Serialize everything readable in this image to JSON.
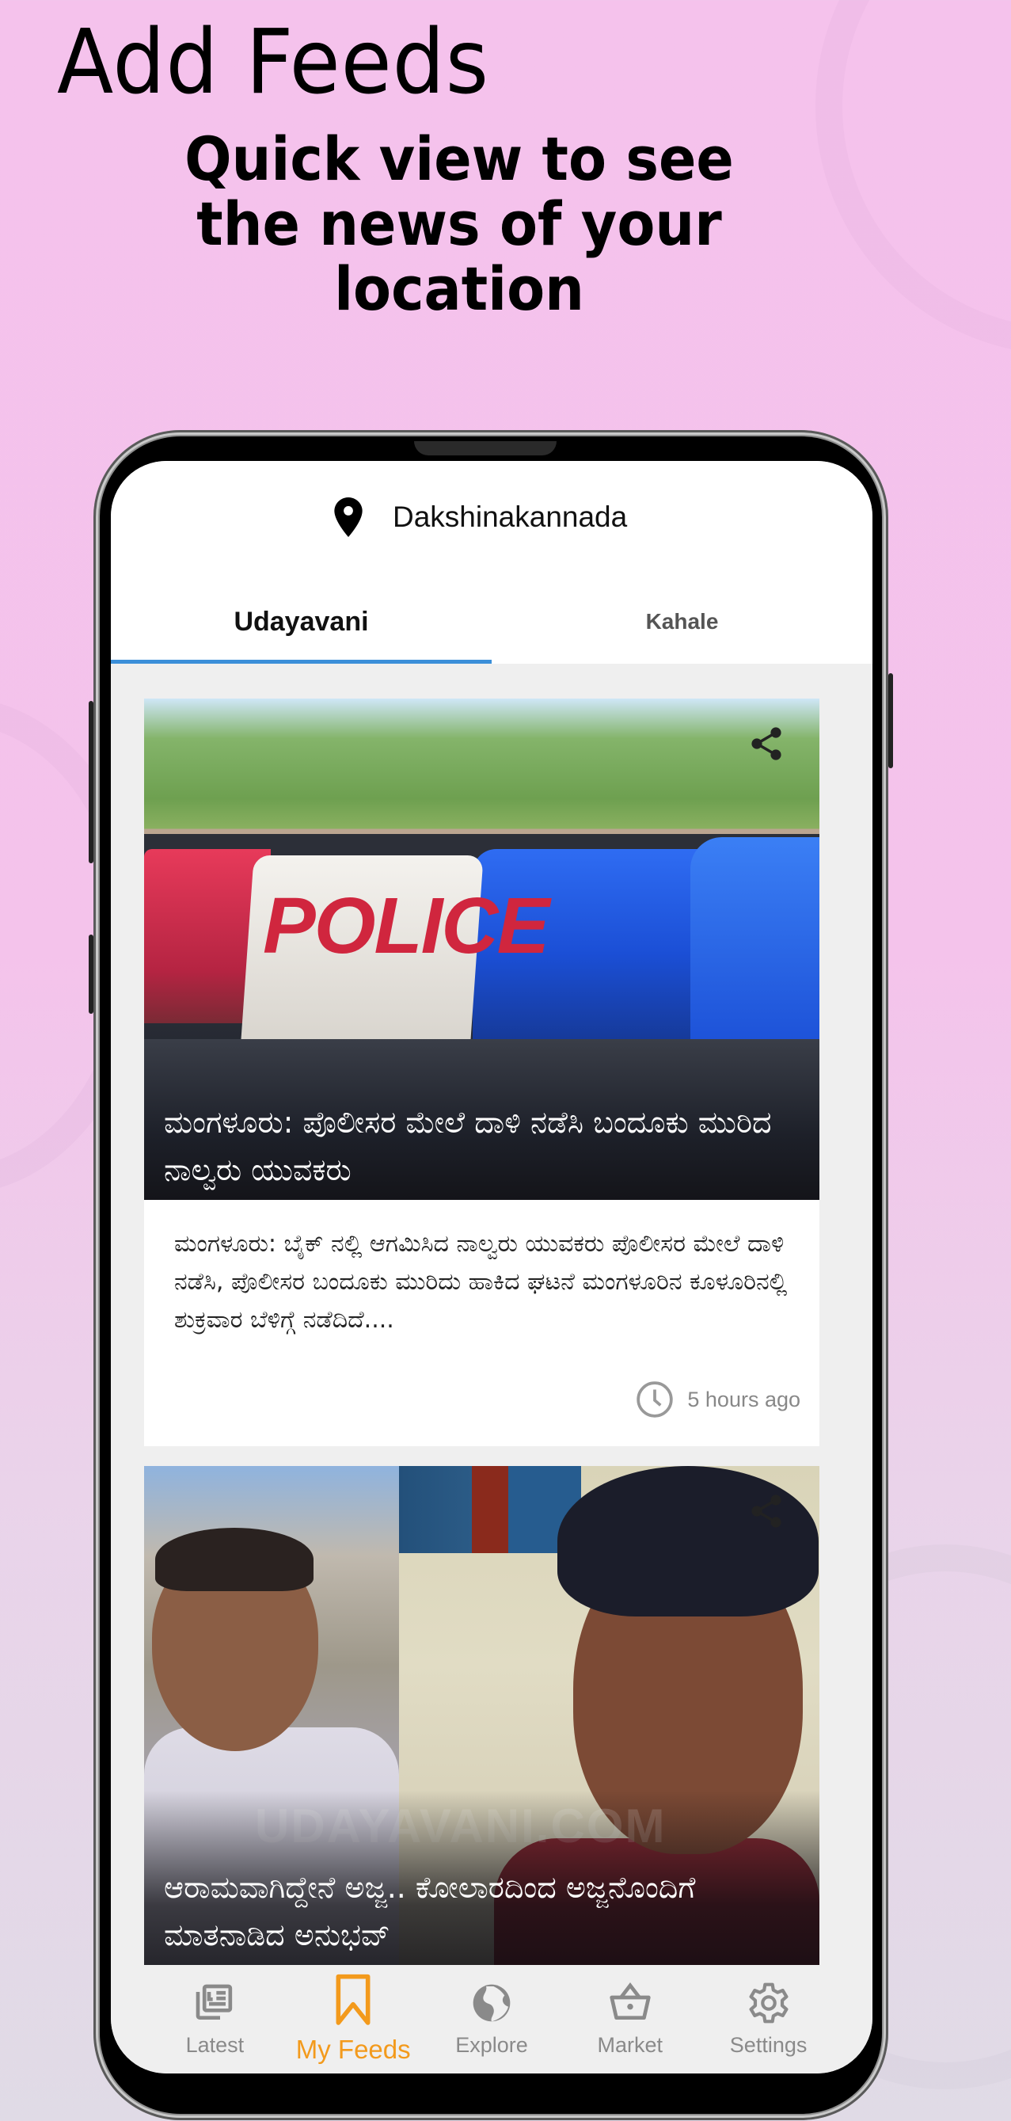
{
  "promo": {
    "headline": "Add Feeds",
    "subhead": "Quick view to see the news of your location"
  },
  "app": {
    "location": {
      "icon": "map-pin-icon",
      "name": "Dakshinakannada"
    },
    "tabs": [
      {
        "label": "Udayavani",
        "active": true
      },
      {
        "label": "Kahale",
        "active": false
      }
    ],
    "accent_color": "#3b8fd9",
    "active_nav_color": "#f39a1c",
    "feed": [
      {
        "image": "police-lightbar-photo",
        "image_text": "POLICE",
        "title": "ಮಂಗಳೂರು: ಪೊಲೀಸರ ಮೇಲೆ ದಾಳಿ ನಡೆಸಿ ಬಂದೂಕು ಮುರಿದ ನಾಲ್ವರು ಯುವಕರು",
        "summary": "ಮಂಗಳೂರು: ಬೈಕ್ ನಲ್ಲಿ ಆಗಮಿಸಿದ ನಾಲ್ವರು ಯುವಕರು ಪೊಲೀಸರ ಮೇಲೆ ದಾಳಿ ನಡೆಸಿ, ಪೊಲೀಸರ ಬಂದೂಕು ಮುರಿದು ಹಾಕಿದ ಘಟನೆ ಮಂಗಳೂರಿನ ಕೂಳೂರಿನಲ್ಲಿ ಶುಕ್ರವಾರ ಬೆಳಿಗ್ಗೆ ನಡೆದಿದೆ....",
        "time": "5 hours ago"
      },
      {
        "image": "grandfather-and-boy-photo",
        "image_text": "UDAYAVANI.COM",
        "title": "ಆರಾಮವಾಗಿದ್ದೇನೆ ಅಜ್ಜ.. ಕೋಲಾರದಿಂದ ಅಜ್ಜನೊಂದಿಗೆ ಮಾತನಾಡಿದ ಅನುಭವ್"
      }
    ],
    "nav": [
      {
        "label": "Latest",
        "icon": "newspaper-icon",
        "active": false
      },
      {
        "label": "My Feeds",
        "icon": "bookmark-icon",
        "active": true
      },
      {
        "label": "Explore",
        "icon": "globe-icon",
        "active": false
      },
      {
        "label": "Market",
        "icon": "basket-icon",
        "active": false
      },
      {
        "label": "Settings",
        "icon": "gear-icon",
        "active": false
      }
    ]
  }
}
